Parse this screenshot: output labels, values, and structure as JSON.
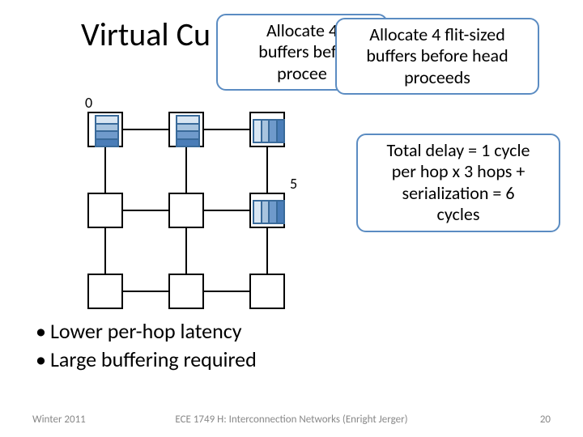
{
  "title": "Virtual Cu",
  "callouts": {
    "behind": "Allocate 4\nbuffers befo\nprocee",
    "front": "Allocate 4 flit-sized\nbuffers before head\nproceeds",
    "delay": "Total delay = 1 cycle\nper hop x 3 hops +\nserialization = 6\ncycles"
  },
  "grid": {
    "labels": {
      "n0": "0",
      "n5": "5"
    },
    "cols": 3,
    "rows": 3,
    "bands": [
      {
        "node": "0",
        "dir": "v"
      },
      {
        "node": "1",
        "dir": "v"
      },
      {
        "node": "2",
        "dir": "h"
      },
      {
        "node": "5",
        "dir": "h"
      }
    ]
  },
  "bullets": [
    "Lower per-hop latency",
    "Large buffering required"
  ],
  "footer": {
    "left": "Winter 2011",
    "center": "ECE 1749 H: Interconnection Networks (Enright Jerger)",
    "right": "20"
  }
}
